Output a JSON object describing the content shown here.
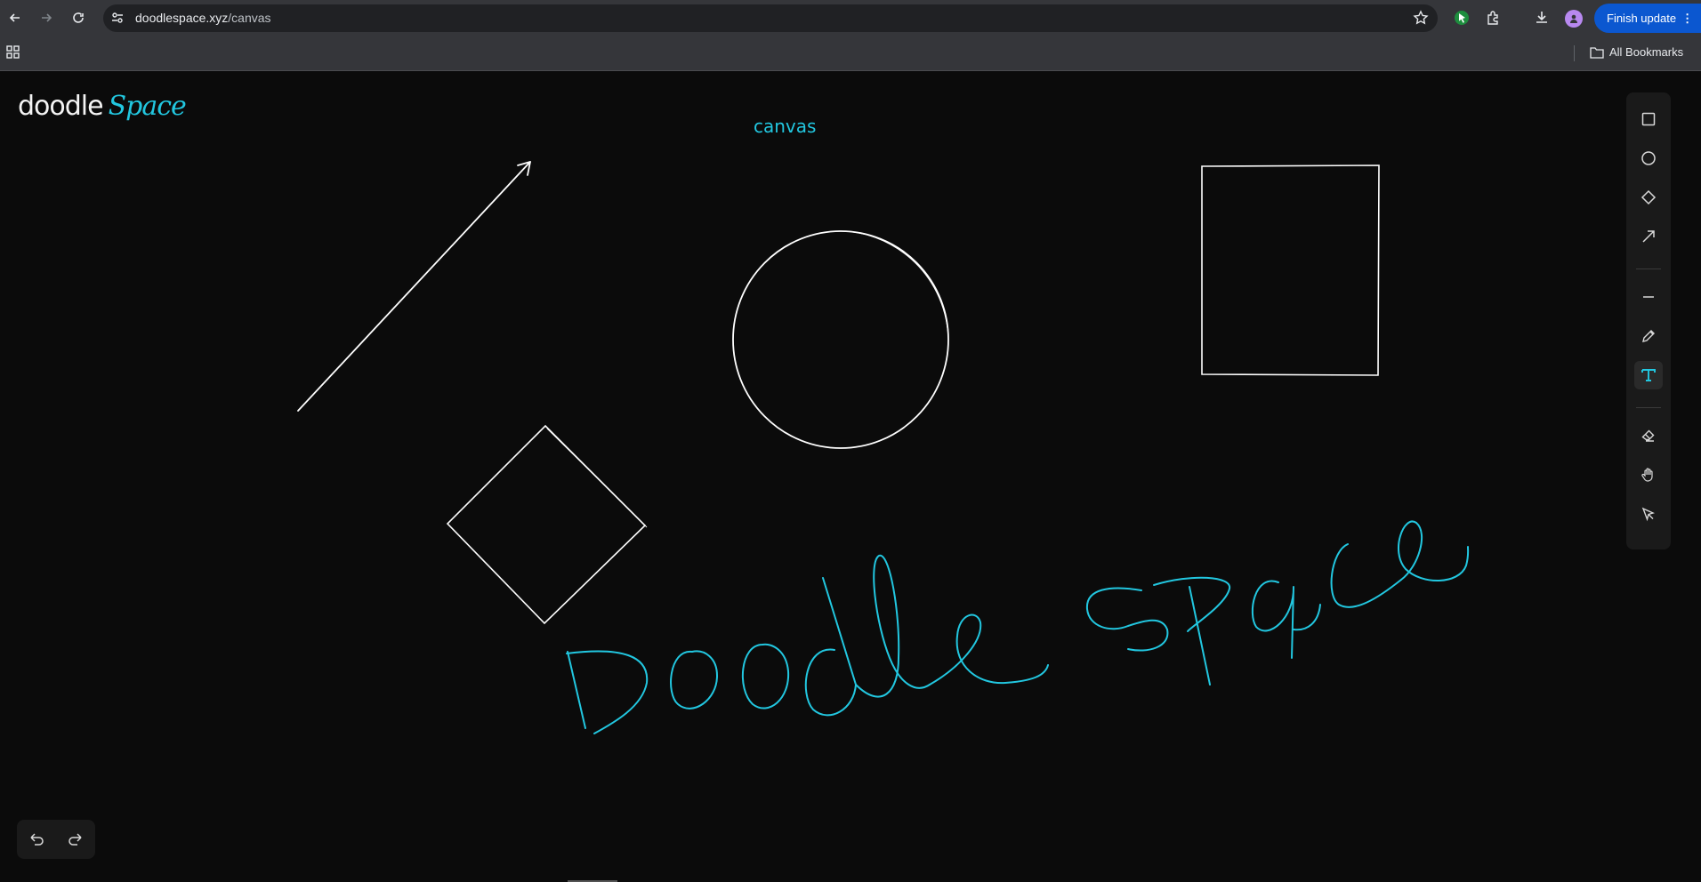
{
  "browser": {
    "url_host": "doodlespace.xyz",
    "url_path": "/canvas",
    "update_button": "Finish update",
    "all_bookmarks": "All Bookmarks",
    "icons": [
      "back-icon",
      "forward-icon",
      "reload-icon",
      "site-settings-icon",
      "star-icon",
      "extension-icon",
      "puzzle-icon",
      "download-icon",
      "apps-icon",
      "folder-icon"
    ]
  },
  "app": {
    "logo_primary": "doodle",
    "logo_secondary": "Space",
    "canvas_title": "canvas",
    "handwriting": "Doodle space",
    "accent_color": "#22c7e0",
    "stroke_color": "#ffffff",
    "background_color": "#0b0b0b"
  },
  "toolbar": {
    "tools": [
      {
        "name": "rectangle",
        "icon": "square-icon",
        "active": false
      },
      {
        "name": "ellipse",
        "icon": "circle-icon",
        "active": false
      },
      {
        "name": "diamond",
        "icon": "diamond-icon",
        "active": false
      },
      {
        "name": "arrow",
        "icon": "arrow-icon",
        "active": false
      },
      {
        "name": "line",
        "icon": "line-icon",
        "active": false
      },
      {
        "name": "pencil",
        "icon": "pencil-icon",
        "active": false
      },
      {
        "name": "text",
        "icon": "text-icon",
        "active": true
      },
      {
        "name": "eraser",
        "icon": "eraser-icon",
        "active": false
      },
      {
        "name": "hand",
        "icon": "hand-icon",
        "active": false
      },
      {
        "name": "select",
        "icon": "pointer-icon",
        "active": false
      }
    ]
  },
  "history": {
    "icons": [
      "undo-icon",
      "redo-icon"
    ]
  }
}
